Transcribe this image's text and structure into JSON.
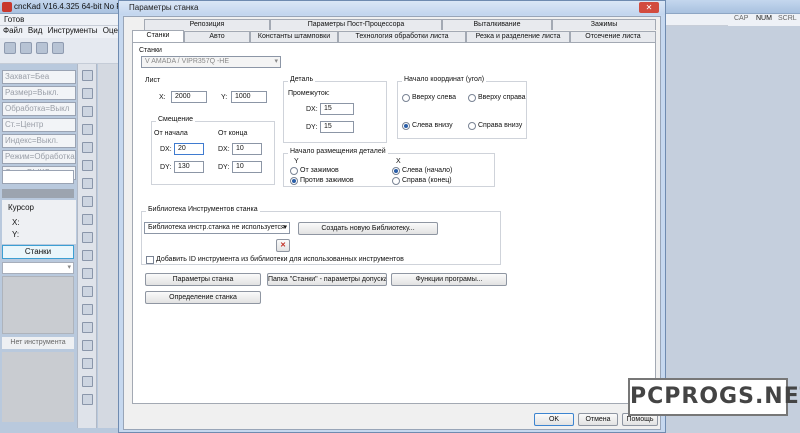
{
  "app": {
    "title": "cncKad V16.4.325 64-bit No Part 'V",
    "status": "Готов",
    "menu": [
      "Файл",
      "Вид",
      "Инструменты",
      "Оце"
    ],
    "indicators": [
      "CAP",
      "NUM",
      "SCRL"
    ],
    "state_items": [
      "Захват=Беа",
      "Размер=Выкл.",
      "Обработка=Выкл",
      "Ст.=Центр",
      "Индекс=Выкл.",
      "Режим=Обработка",
      "Лист=ВЫКЛ"
    ],
    "cursor_label": "Курсор",
    "x_label": "X:",
    "y_label": "Y:",
    "stanki_button": "Станки",
    "no_tool": "Нет инструмента"
  },
  "dialog": {
    "title": "Параметры станка",
    "close_glyph": "✕",
    "tabs_back": [
      "Репозиция",
      "Параметры Пост-Процессора",
      "Выталкивание",
      "Зажимы"
    ],
    "tabs_front": [
      "Станки",
      "Авто",
      "Константы штамповки",
      "Технология обработки листа",
      "Резка и разделение листа",
      "Отсечение листа"
    ],
    "machines_label": "Станки",
    "machine_value": "V  AMADA / VIPR357Q  -HE",
    "sheet": {
      "title": "Лист",
      "x_label": "X:",
      "x_value": "2000",
      "y_label": "Y:",
      "y_value": "1000",
      "offset_title": "Смещение",
      "from_start": "От начала",
      "from_end": "От конца",
      "dx_label": "DX:",
      "dy_label": "DY:",
      "dx_start": "20",
      "dx_end": "10",
      "dy_start": "130",
      "dy_end": "10"
    },
    "part": {
      "title": "Деталь",
      "gap_label": "Промежуток:",
      "dx_label": "DX:",
      "dx_value": "15",
      "dy_label": "DY:",
      "dy_value": "15"
    },
    "origin": {
      "title": "Начало координат (угол)",
      "top_left": "Вверху слева",
      "top_right": "Вверху справа",
      "bottom_left": "Слева внизу",
      "bottom_right": "Справа внизу",
      "selected": "bottom_left"
    },
    "placement": {
      "title": "Начало размещения деталей",
      "y_header": "Y",
      "x_header": "X",
      "from_clamps": "От зажимов",
      "against_clamps": "Против зажимов",
      "left_start": "Слева (начало)",
      "right_end": "Справа (конец)"
    },
    "library": {
      "title": "Библиотека Инструментов станка",
      "combo_value": "Библиотека инстр.станка не используется",
      "create_button": "Создать новую Библиотеку...",
      "delete_glyph": "✕",
      "add_id_label": "Добавить ID инструмента из библиотеки для использованных инструментов"
    },
    "buttons": {
      "machine_params": "Параметры станка",
      "folder_params": "Папка \"Станки\" - параметры допуска",
      "program_functions": "Функции програмы...",
      "machine_definition": "Определение станка",
      "ok": "OK",
      "cancel": "Отмена",
      "help": "Помощь"
    }
  },
  "watermark": "PCPROGS.NET"
}
